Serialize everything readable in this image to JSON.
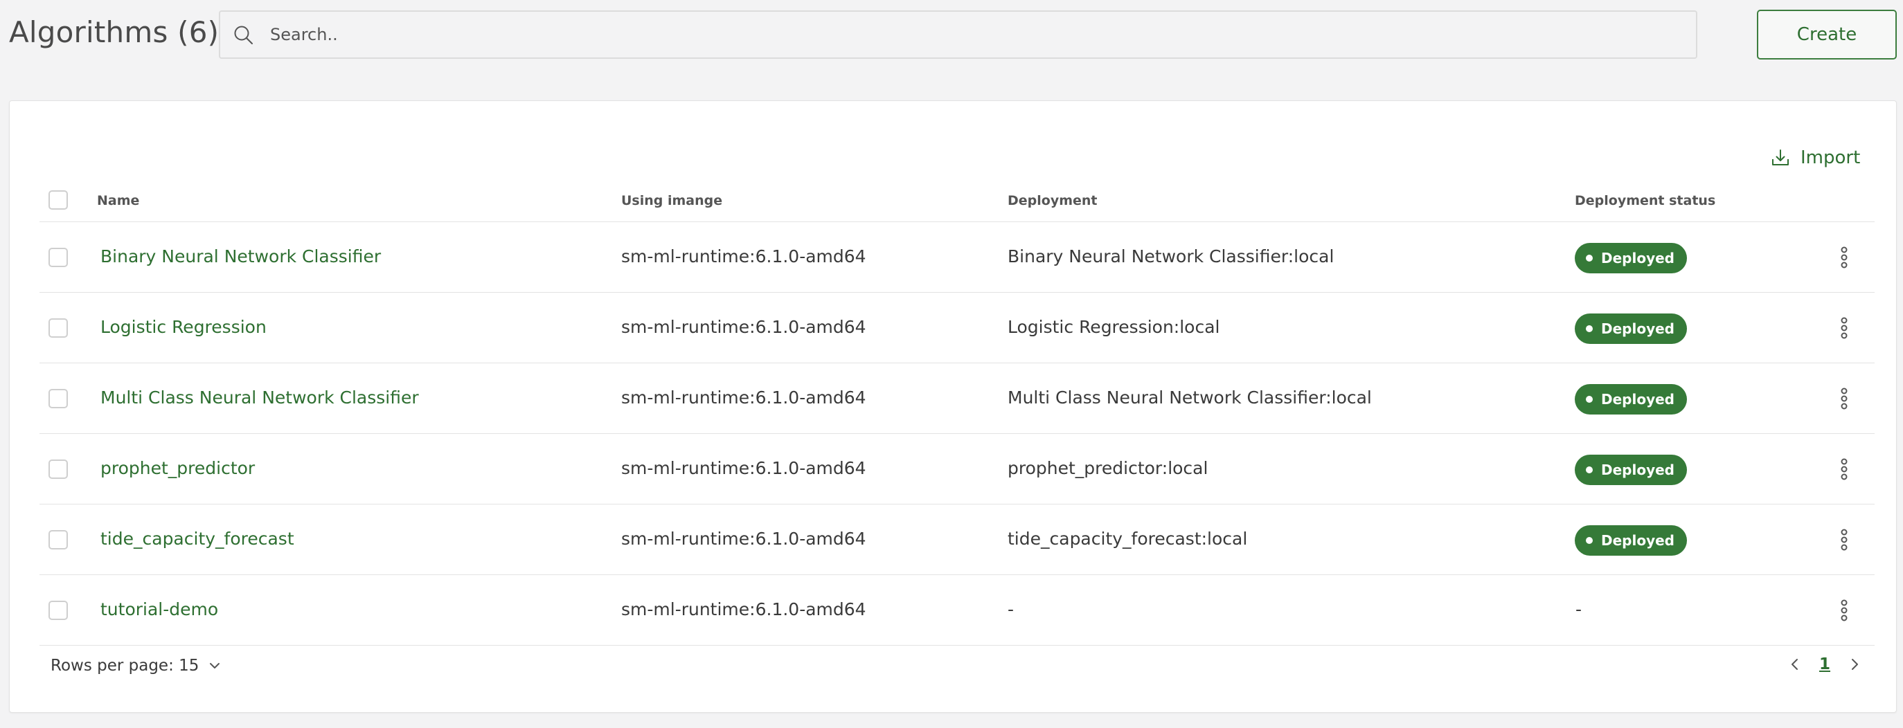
{
  "header": {
    "title": "Algorithms (6)",
    "search_placeholder": "Search..",
    "create_label": "Create"
  },
  "toolbar": {
    "import_label": "Import"
  },
  "table": {
    "columns": {
      "name": "Name",
      "image": "Using imange",
      "deployment": "Deployment",
      "status": "Deployment status"
    },
    "rows": [
      {
        "name": "Binary Neural Network Classifier",
        "image": "sm-ml-runtime:6.1.0-amd64",
        "deployment": "Binary Neural Network Classifier:local",
        "status": "Deployed"
      },
      {
        "name": "Logistic Regression",
        "image": "sm-ml-runtime:6.1.0-amd64",
        "deployment": "Logistic Regression:local",
        "status": "Deployed"
      },
      {
        "name": "Multi Class Neural Network Classifier",
        "image": "sm-ml-runtime:6.1.0-amd64",
        "deployment": "Multi Class Neural Network Classifier:local",
        "status": "Deployed"
      },
      {
        "name": "prophet_predictor",
        "image": "sm-ml-runtime:6.1.0-amd64",
        "deployment": "prophet_predictor:local",
        "status": "Deployed"
      },
      {
        "name": "tide_capacity_forecast",
        "image": "sm-ml-runtime:6.1.0-amd64",
        "deployment": "tide_capacity_forecast:local",
        "status": "Deployed"
      },
      {
        "name": "tutorial-demo",
        "image": "sm-ml-runtime:6.1.0-amd64",
        "deployment": "-",
        "status": "-"
      }
    ]
  },
  "footer": {
    "rows_per_page": "Rows per page: 15",
    "current_page": "1"
  },
  "colors": {
    "accent": "#2e6f31",
    "badge": "#357a38",
    "background": "#f3f3f4"
  },
  "icons": {
    "search": "search-icon",
    "import": "import-icon",
    "more": "kebab-menu-icon",
    "rows_dropdown": "chevron-down-icon",
    "prev": "chevron-left-icon",
    "next": "chevron-right-icon"
  }
}
